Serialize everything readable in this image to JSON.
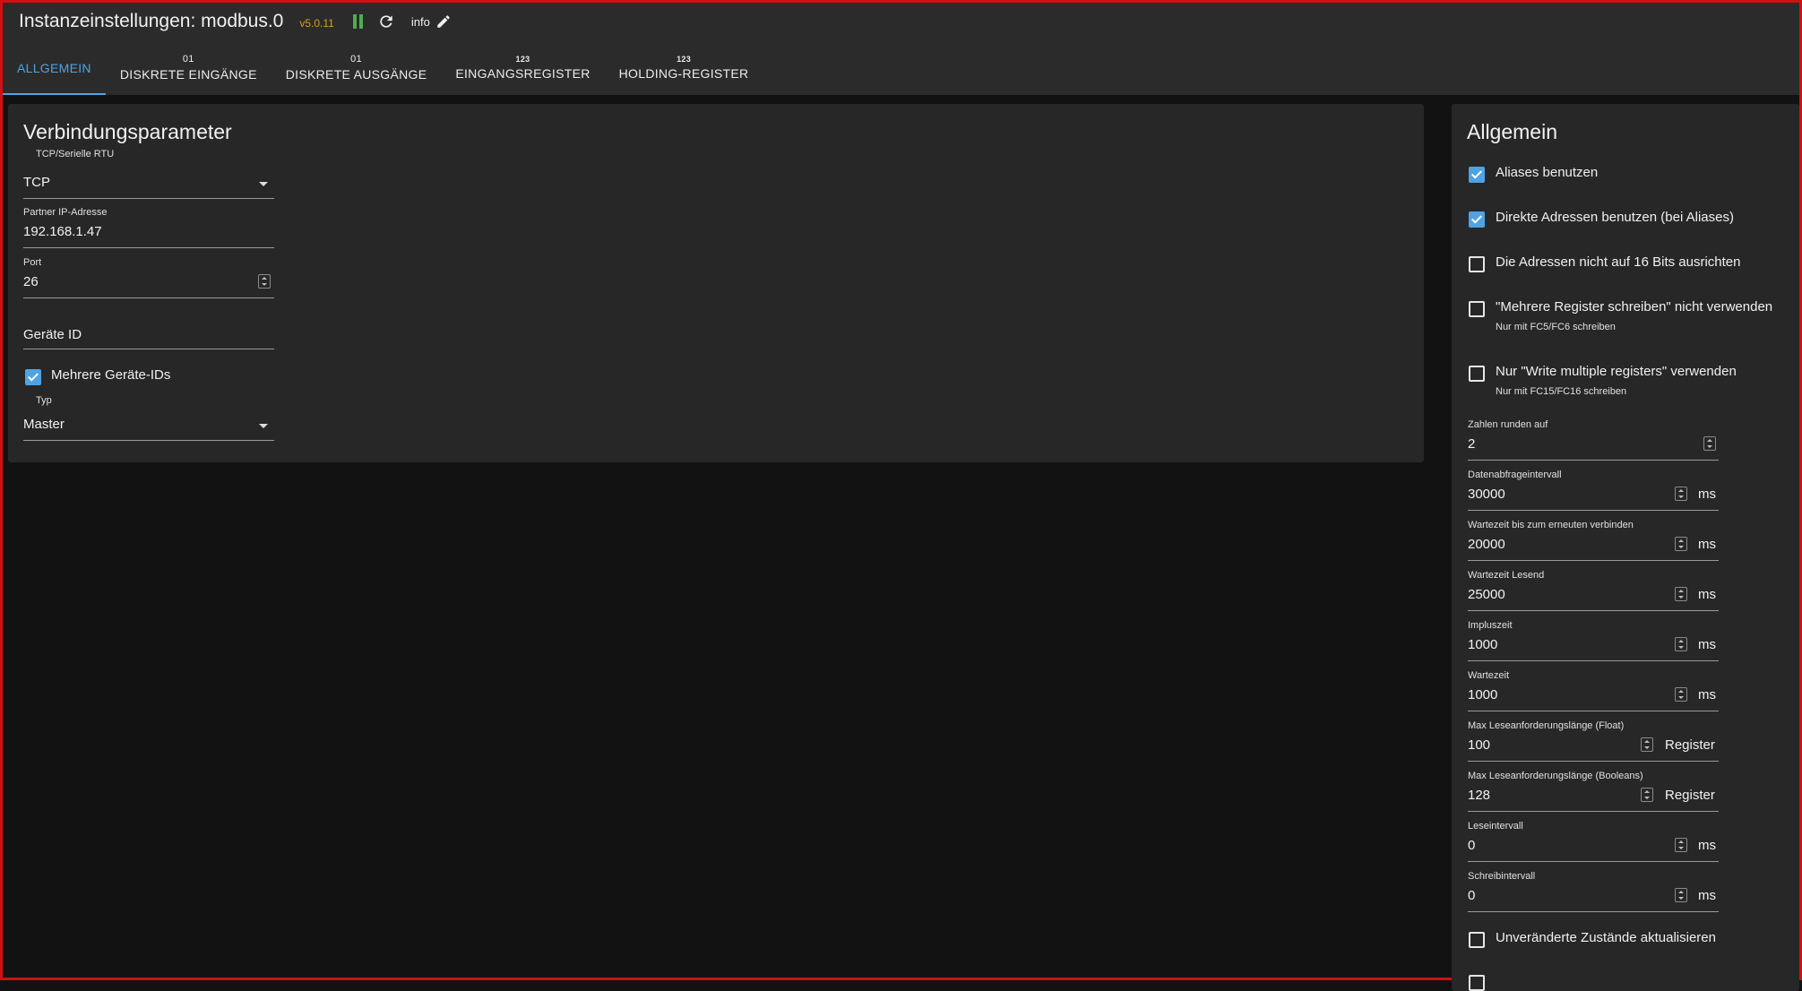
{
  "header": {
    "title": "Instanzeinstellungen: modbus.0",
    "version": "v5.0.11",
    "info_label": "info"
  },
  "tabs": [
    {
      "sup": "",
      "label": "ALLGEMEIN",
      "active": true
    },
    {
      "sup": "01",
      "label": "DISKRETE EINGÄNGE"
    },
    {
      "sup": "01",
      "label": "DISKRETE AUSGÄNGE"
    },
    {
      "sup": "123",
      "label": "EINGANGSREGISTER"
    },
    {
      "sup": "123",
      "label": "HOLDING-REGISTER"
    }
  ],
  "connection": {
    "title": "Verbindungsparameter",
    "mode": {
      "label": "TCP/Serielle RTU",
      "value": "TCP"
    },
    "ip": {
      "label": "Partner IP-Adresse",
      "value": "192.168.1.47"
    },
    "port": {
      "label": "Port",
      "value": "26"
    },
    "device_id": {
      "placeholder": "Geräte ID"
    },
    "multi_ids": {
      "label": "Mehrere Geräte-IDs",
      "checked": true
    },
    "type": {
      "label": "Typ",
      "value": "Master"
    }
  },
  "general": {
    "title": "Allgemein",
    "checkboxes": [
      {
        "label": "Aliases benutzen",
        "checked": true,
        "hint": ""
      },
      {
        "label": "Direkte Adressen benutzen (bei Aliases)",
        "checked": true,
        "hint": ""
      },
      {
        "label": "Die Adressen nicht auf 16 Bits ausrichten",
        "checked": false,
        "hint": ""
      },
      {
        "label": "\"Mehrere Register schreiben\" nicht verwenden",
        "checked": false,
        "hint": "Nur mit FC5/FC6 schreiben"
      },
      {
        "label": "Nur \"Write multiple registers\" verwenden",
        "checked": false,
        "hint": "Nur mit FC15/FC16 schreiben"
      }
    ],
    "numbers": [
      {
        "label": "Zahlen runden auf",
        "value": "2",
        "unit": ""
      },
      {
        "label": "Datenabfrageintervall",
        "value": "30000",
        "unit": "ms"
      },
      {
        "label": "Wartezeit bis zum erneuten verbinden",
        "value": "20000",
        "unit": "ms"
      },
      {
        "label": "Wartezeit Lesend",
        "value": "25000",
        "unit": "ms"
      },
      {
        "label": "Impluszeit",
        "value": "1000",
        "unit": "ms"
      },
      {
        "label": "Wartezeit",
        "value": "1000",
        "unit": "ms"
      },
      {
        "label": "Max Leseanforderungslänge (Float)",
        "value": "100",
        "unit": "Register"
      },
      {
        "label": "Max Leseanforderungslänge (Booleans)",
        "value": "128",
        "unit": "Register"
      },
      {
        "label": "Leseintervall",
        "value": "0",
        "unit": "ms"
      },
      {
        "label": "Schreibintervall",
        "value": "0",
        "unit": "ms"
      }
    ],
    "bottom_checkbox": {
      "label": "Unveränderte Zustände aktualisieren",
      "checked": false
    }
  },
  "colors": {
    "accent": "#4fa3e3",
    "version": "#d4a017",
    "pause": "#4caf50",
    "frame": "#d01010"
  }
}
